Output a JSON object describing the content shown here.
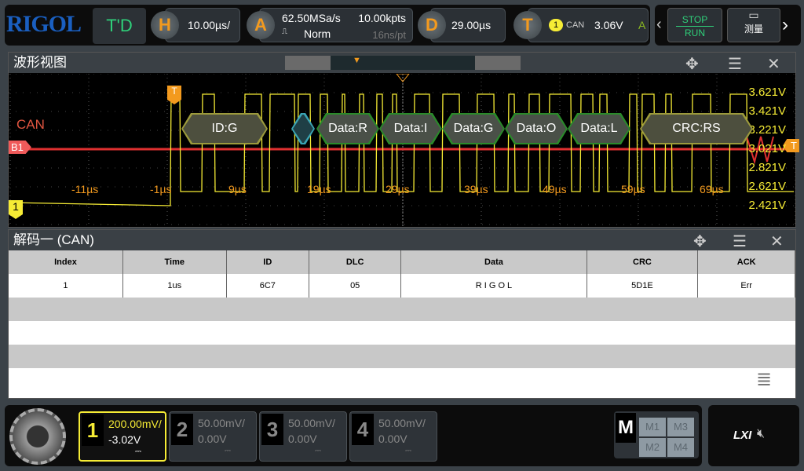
{
  "header": {
    "logo": "RIGOL",
    "mode": "T'D",
    "h_label": "H",
    "h_scale": "10.00µs/",
    "a_label": "A",
    "sample_rate": "62.50MSa/s",
    "mem_depth": "10.00kpts",
    "acq_mode": "Norm",
    "resolution": "16ns/pt",
    "d_label": "D",
    "delay": "29.00µs",
    "t_label": "T",
    "trig_source": "1",
    "trig_type": "CAN",
    "trig_level": "3.06V",
    "trig_mode": "A",
    "stop_label": "STOP",
    "run_label": "RUN",
    "measure_label": "测量"
  },
  "waveform": {
    "title": "波形视图",
    "bus_label": "CAN",
    "bus_tag": "B1",
    "ch_tag": "1",
    "trig_marker": "T",
    "time_labels": [
      "-11µs",
      "-1µs",
      "9µs",
      "19µs",
      "29µs",
      "39µs",
      "49µs",
      "59µs",
      "69µs"
    ],
    "volt_labels": [
      "3.621V",
      "3.421V",
      "3.221V",
      "3.021V",
      "2.821V",
      "2.621V",
      "2.421V"
    ],
    "packets": [
      {
        "label": "ID:G",
        "kind": "id"
      },
      {
        "label": "",
        "kind": "ctrl"
      },
      {
        "label": "Data:R",
        "kind": "data"
      },
      {
        "label": "Data:I",
        "kind": "data"
      },
      {
        "label": "Data:G",
        "kind": "data"
      },
      {
        "label": "Data:O",
        "kind": "data"
      },
      {
        "label": "Data:L",
        "kind": "data"
      },
      {
        "label": "CRC:RS",
        "kind": "crc"
      }
    ],
    "colors": {
      "ch1": "#f6ec35",
      "bus": "#e03030",
      "accent": "#f39a1e"
    }
  },
  "decode": {
    "title": "解码一 (CAN)",
    "columns": [
      "Index",
      "Time",
      "ID",
      "DLC",
      "Data",
      "CRC",
      "ACK"
    ],
    "rows": [
      [
        "1",
        "1us",
        "6C7",
        "05",
        "R I G O L",
        "5D1E",
        "Err"
      ]
    ]
  },
  "channels": [
    {
      "num": "1",
      "scale": "200.00mV/",
      "offset": "-3.02V",
      "active": true
    },
    {
      "num": "2",
      "scale": "50.00mV/",
      "offset": "0.00V"
    },
    {
      "num": "3",
      "scale": "50.00mV/",
      "offset": "0.00V"
    },
    {
      "num": "4",
      "scale": "50.00mV/",
      "offset": "0.00V"
    }
  ],
  "math": {
    "label": "M",
    "items": [
      "M1",
      "M3",
      "M2",
      "M4"
    ]
  },
  "status": {
    "lxi": "LXI"
  }
}
